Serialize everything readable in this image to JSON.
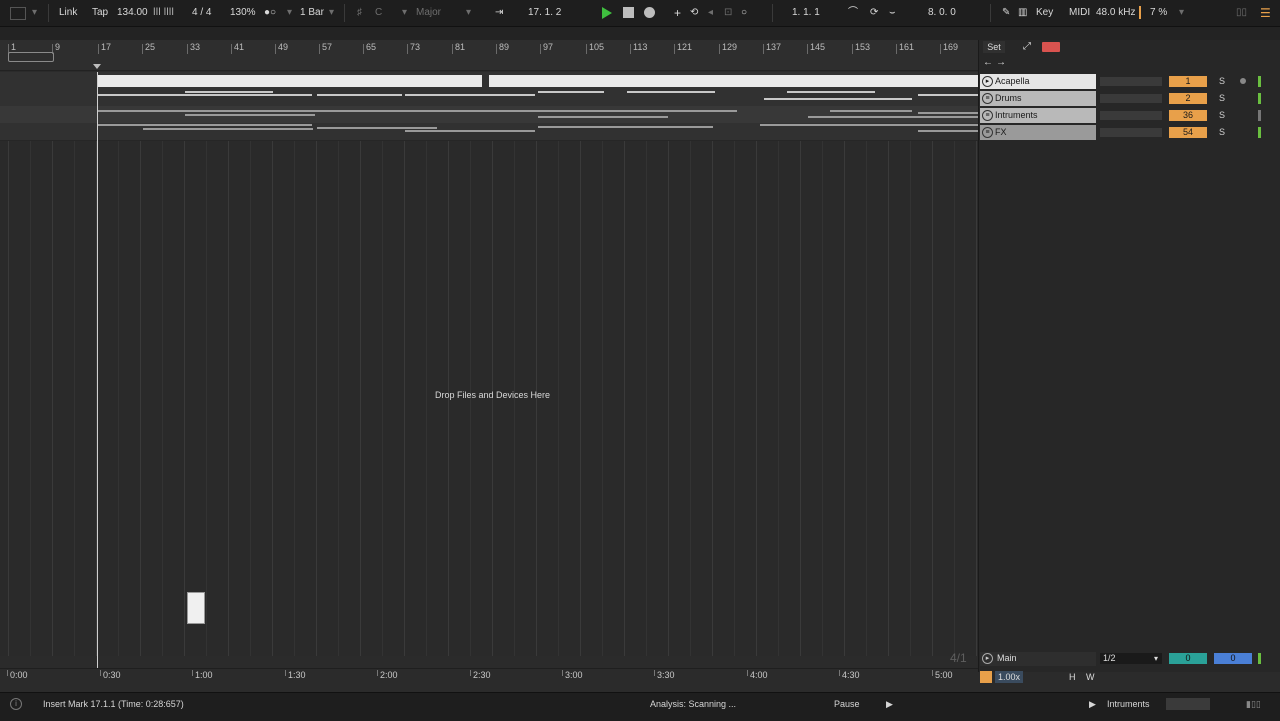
{
  "toolbar": {
    "link": "Link",
    "tap": "Tap",
    "tempo": "134.00",
    "signature": "4 / 4",
    "zoom": "130%",
    "quantize": "1 Bar",
    "key_root": "C",
    "key_scale": "Major",
    "position": "17.  1.  2",
    "loop_start": "1.  1.  1",
    "loop_length": "8.  0.  0",
    "key_button": "Key",
    "midi_button": "MIDI",
    "sample_rate": "48.0 kHz",
    "cpu": "7 %"
  },
  "ruler": {
    "bars": [
      "1",
      "9",
      "17",
      "25",
      "33",
      "41",
      "49",
      "57",
      "65",
      "73",
      "81",
      "89",
      "97",
      "105",
      "113",
      "121",
      "129",
      "137",
      "145",
      "153",
      "161",
      "169"
    ],
    "set_button": "Set"
  },
  "tracks": [
    {
      "name": "Acapella",
      "number": "1",
      "solo": "S"
    },
    {
      "name": "Drums",
      "number": "2",
      "solo": "S"
    },
    {
      "name": "Intruments",
      "number": "36",
      "solo": "S"
    },
    {
      "name": "FX",
      "number": "54",
      "solo": "S"
    }
  ],
  "arrangement": {
    "drop_hint": "Drop Files and Devices Here"
  },
  "main_track": {
    "fraction": "4/1",
    "name": "Main",
    "split": "1/2",
    "send_a": "0",
    "send_b": "0",
    "tempo_scale": "1.00x",
    "h_button": "H",
    "w_button": "W"
  },
  "time_ruler": [
    "0:00",
    "0:30",
    "1:00",
    "1:30",
    "2:00",
    "2:30",
    "3:00",
    "3:30",
    "4:00",
    "4:30",
    "5:00"
  ],
  "status": {
    "message": "Insert Mark 17.1.1 (Time: 0:28:657)",
    "analysis": "Analysis: Scanning ...",
    "pause": "Pause",
    "track_name": "Intruments"
  },
  "colors": {
    "accent_orange": "#e8a04a",
    "play_green": "#3fbf3f",
    "send_teal": "#2aa198",
    "send_blue": "#4a7fd6"
  }
}
